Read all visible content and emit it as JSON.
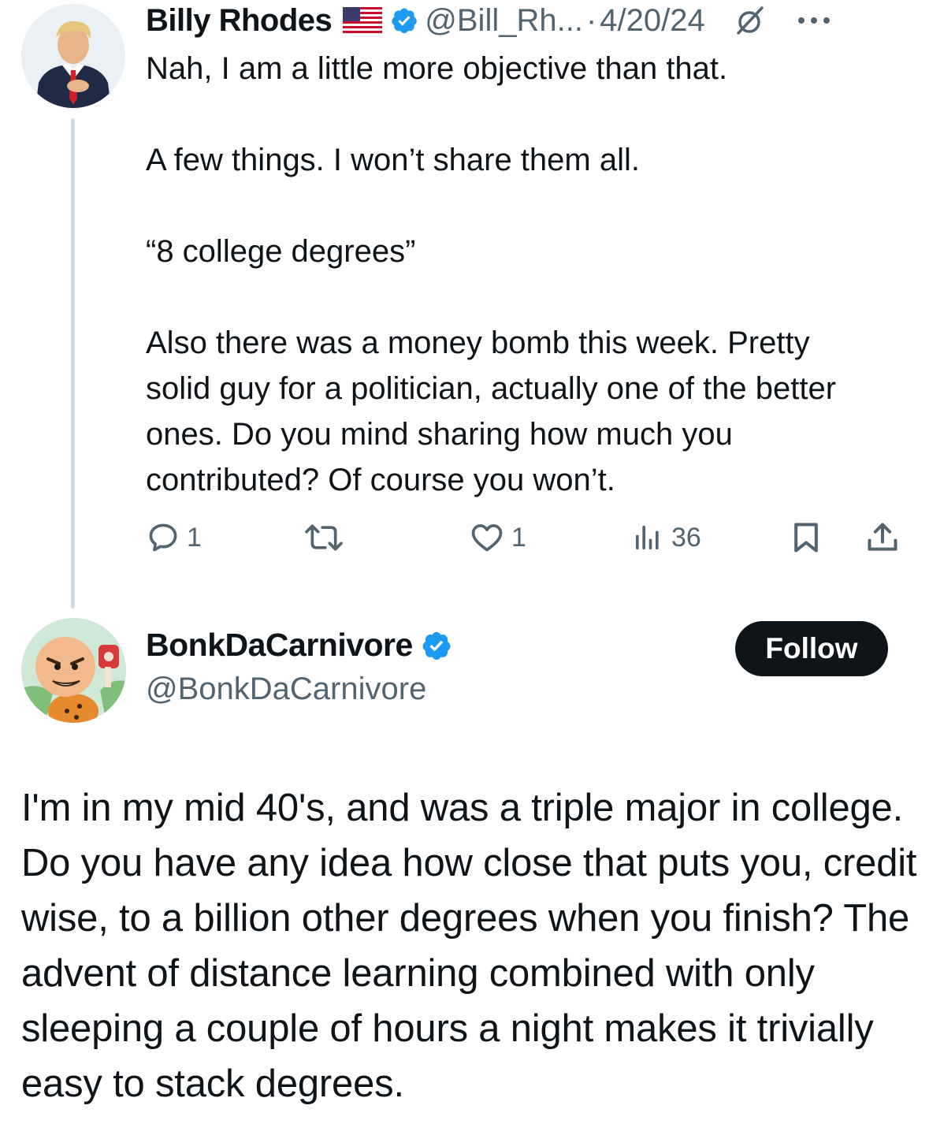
{
  "reply_tweet": {
    "author_name": "Billy Rhodes",
    "handle": "@Bill_Rh...",
    "separator": "·",
    "date": "4/20/24",
    "paragraphs": [
      "Nah, I am a little more objective than that.",
      "A few things. I won’t share them all.",
      "“8 college degrees”",
      "Also there was a money bomb this week. Pretty solid guy for a politician, actually one of the better ones. Do you mind sharing how much you contributed? Of course you won’t."
    ],
    "actions": {
      "reply_count": "1",
      "retweet_count": "",
      "like_count": "1",
      "view_count": "36"
    },
    "icons": [
      "flag-us-icon",
      "verified-badge-icon",
      "grok-icon",
      "more-icon",
      "reply-icon",
      "retweet-icon",
      "like-icon",
      "views-icon",
      "bookmark-icon",
      "share-icon"
    ]
  },
  "main_tweet": {
    "author_name": "BonkDaCarnivore",
    "handle": "@BonkDaCarnivore",
    "follow_label": "Follow",
    "text": "I'm in my mid 40's, and was a triple major in college.  Do you have any idea how close that puts you, credit wise, to a billion other degrees when you finish?  The advent of distance learning combined with only sleeping a couple of hours a night makes it trivially easy to stack degrees."
  },
  "colors": {
    "text_primary": "#0f1419",
    "text_secondary": "#536471",
    "verified_blue": "#1d9bf0",
    "thread_line": "#cfd9de",
    "follow_bg": "#0f1419"
  }
}
